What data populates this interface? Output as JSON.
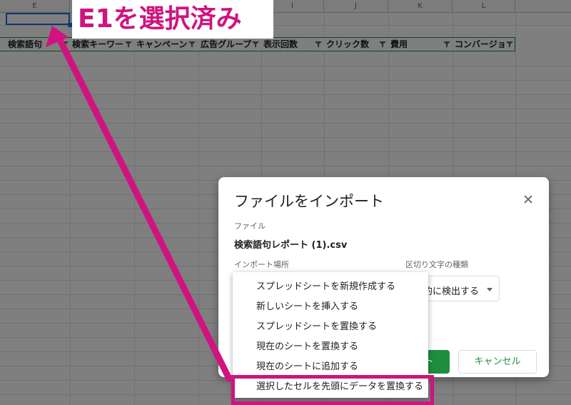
{
  "sheet": {
    "columns": [
      "E",
      "I",
      "J",
      "K",
      "L"
    ],
    "headers": [
      "検索語句",
      "検索キーワー",
      "キャンペーン",
      "広告グループ",
      "表示回数",
      "クリック数",
      "費用",
      "コンバージョ"
    ]
  },
  "annotation": {
    "callout": "E1を選択済み",
    "arrow_color": "#d0137e"
  },
  "dialog": {
    "title": "ファイルをインポート",
    "file_label": "ファイル",
    "file_name": "検索語句レポート (1).csv",
    "location_label": "インポート場所",
    "separator_label": "区切り文字の種類",
    "separator_value": "的に検出する",
    "import_button": "ト",
    "cancel_button": "キャンセル",
    "location_options": [
      "スプレッドシートを新規作成する",
      "新しいシートを挿入する",
      "スプレッドシートを置換する",
      "現在のシートを置換する",
      "現在のシートに追加する",
      "選択したセルを先頭にデータを置換する"
    ],
    "highlighted_option_index": 5
  },
  "colors": {
    "accent_green": "#1e8e3e",
    "annotation_magenta": "#d0137e",
    "selection_blue": "#1a73e8"
  },
  "icons": {
    "close": "close-icon",
    "filter": "filter-icon",
    "dropdown": "chevron-down-icon"
  }
}
